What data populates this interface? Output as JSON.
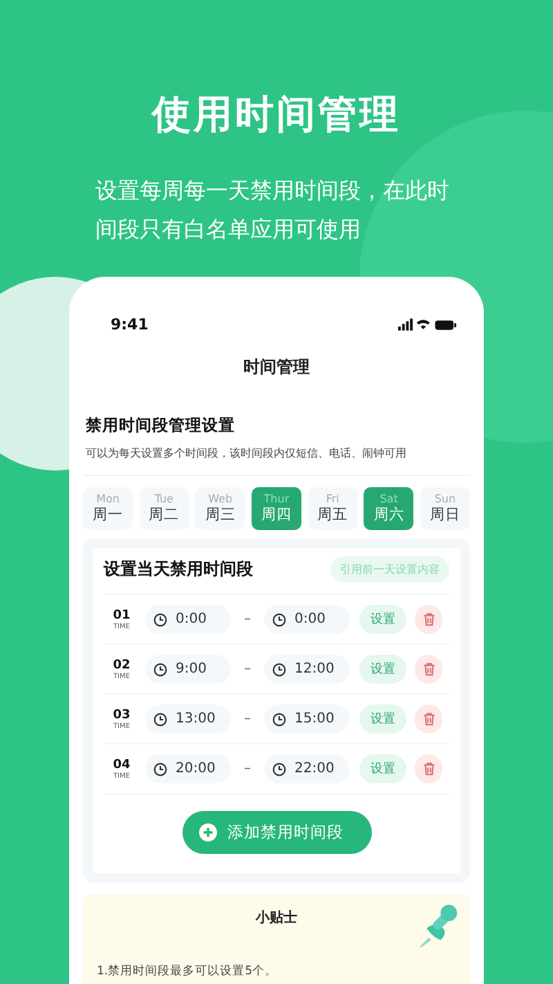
{
  "headline": "使用时间管理",
  "subtitle": "设置每周每一天禁用时间段，在此时间段只有白名单应用可使用",
  "status_bar": {
    "time": "9:41"
  },
  "nav": {
    "title": "时间管理"
  },
  "intro": {
    "title": "禁用时间段管理设置",
    "text": "可以为每天设置多个时间段，该时间段内仅短信、电话、闹钟可用"
  },
  "days": [
    {
      "en": "Mon",
      "zh": "周一",
      "selected": false
    },
    {
      "en": "Tue",
      "zh": "周二",
      "selected": false
    },
    {
      "en": "Web",
      "zh": "周三",
      "selected": false
    },
    {
      "en": "Thur",
      "zh": "周四",
      "selected": true
    },
    {
      "en": "Fri",
      "zh": "周五",
      "selected": false
    },
    {
      "en": "Sat",
      "zh": "周六",
      "selected": true
    },
    {
      "en": "Sun",
      "zh": "周日",
      "selected": false
    }
  ],
  "periods_panel": {
    "title": "设置当天禁用时间段",
    "copy_button": "引用前一天设置内容",
    "periods": [
      {
        "index": "01",
        "label": "TIME",
        "start": "0:00",
        "dash": "–",
        "end": "0:00",
        "set_button": "设置"
      },
      {
        "index": "02",
        "label": "TIME",
        "start": "9:00",
        "dash": "–",
        "end": "12:00",
        "set_button": "设置"
      },
      {
        "index": "03",
        "label": "TIME",
        "start": "13:00",
        "dash": "–",
        "end": "15:00",
        "set_button": "设置"
      },
      {
        "index": "04",
        "label": "TIME",
        "start": "20:00",
        "dash": "–",
        "end": "22:00",
        "set_button": "设置"
      }
    ],
    "add_button": "添加禁用时间段"
  },
  "tips": {
    "title": "小贴士",
    "items": [
      "1.禁用时间段最多可以设置5个。"
    ]
  }
}
